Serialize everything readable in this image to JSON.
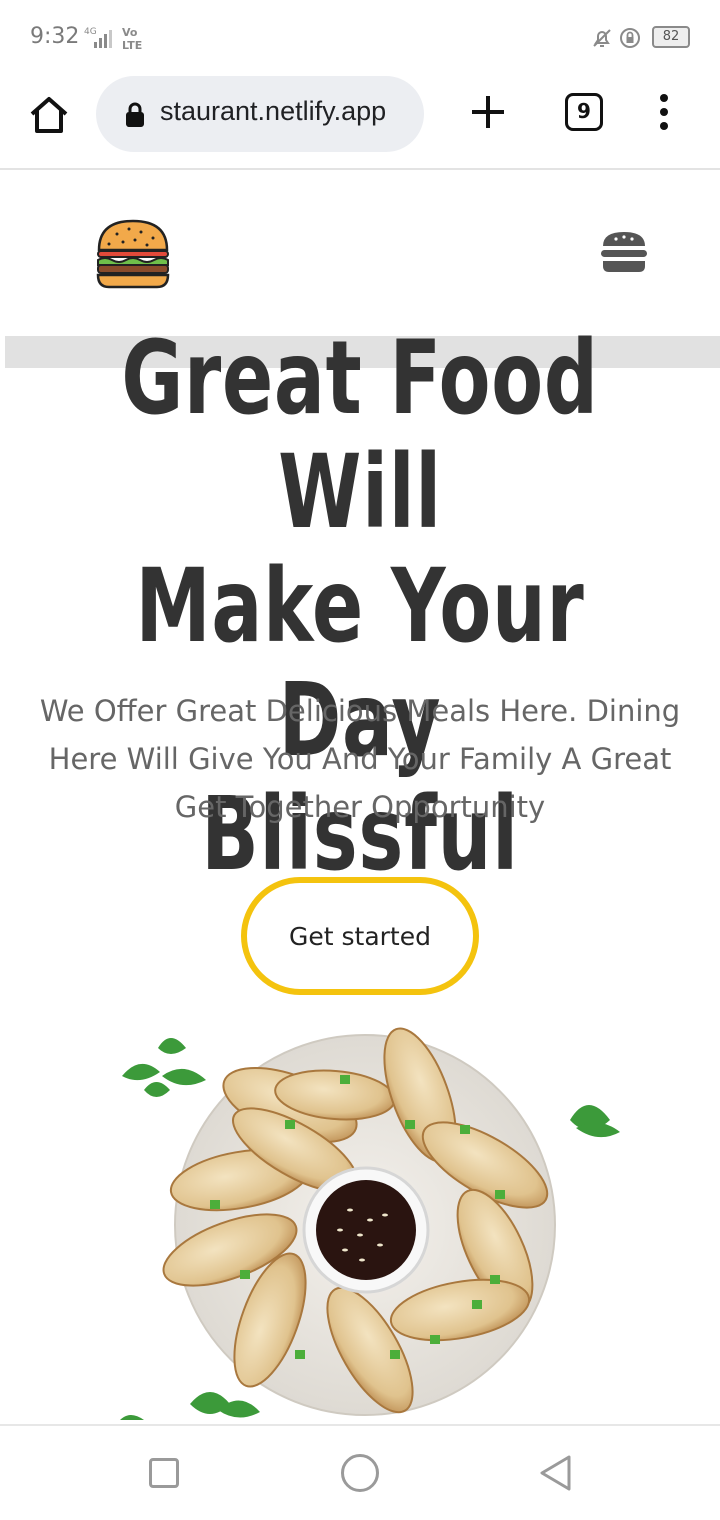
{
  "status_bar": {
    "time": "9:32",
    "network": "4G",
    "volte": "Vo LTE",
    "battery": "82"
  },
  "browser": {
    "url": "staurant.netlify.app",
    "tab_count": "9"
  },
  "hero": {
    "title_line1": "Great Food Will",
    "title_line2": "Make Your Day",
    "title_line3": "Blissful",
    "subtitle": "We Offer Great Delicious Meals Here. Dining Here Will Give You And Your Family A Great Get Together Opportunity",
    "cta_label": "Get started"
  },
  "colors": {
    "accent": "#f4c30e",
    "title_text": "#333333",
    "body_text": "#666666"
  },
  "icons": {
    "home": "home-icon",
    "lock": "lock-icon",
    "new_tab": "plus-icon",
    "menu": "more-vert-icon",
    "logo": "burger-logo",
    "nav_menu": "hamburger-menu-icon"
  }
}
